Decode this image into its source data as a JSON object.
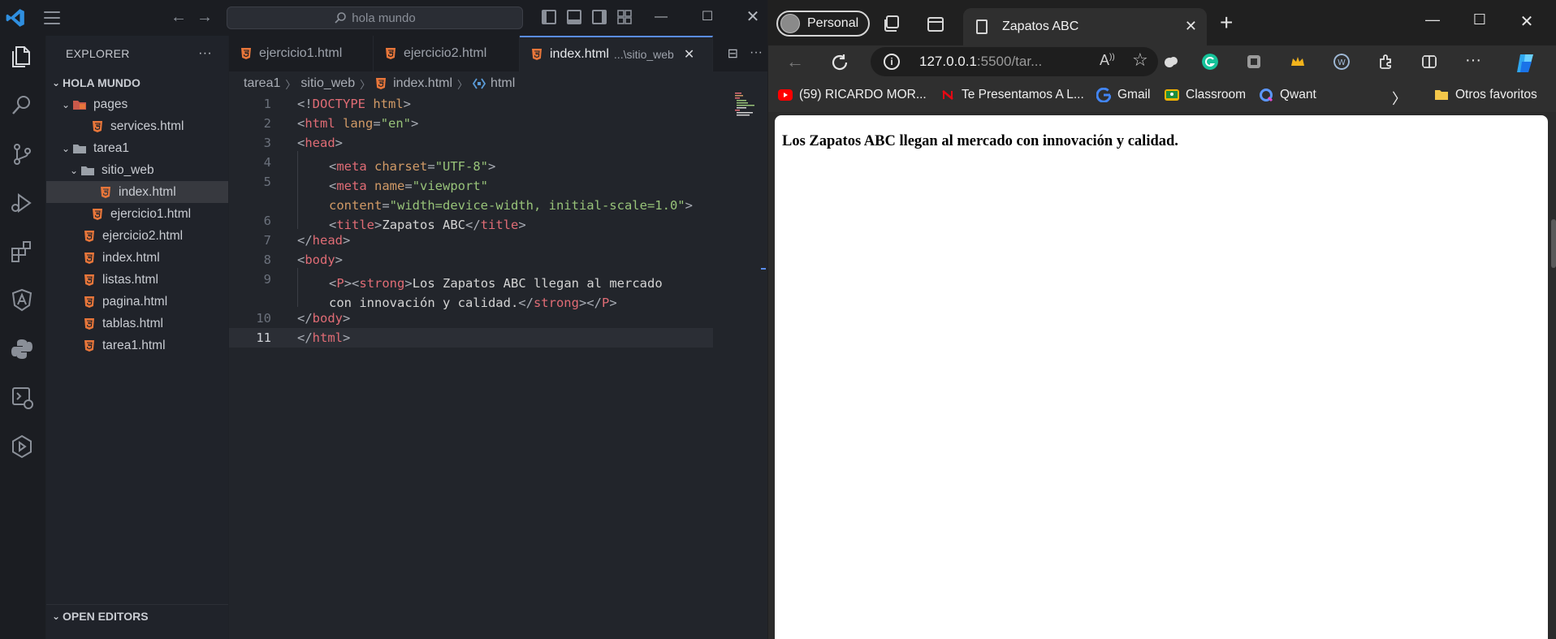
{
  "vscode": {
    "search_text": "hola mundo",
    "explorer": {
      "title": "EXPLORER",
      "more": "···",
      "root": "HOLA MUNDO",
      "items": [
        {
          "label": "pages",
          "kind": "folder"
        },
        {
          "label": "services.html",
          "kind": "file"
        },
        {
          "label": "tarea1",
          "kind": "folder"
        },
        {
          "label": "sitio_web",
          "kind": "folder"
        },
        {
          "label": "index.html",
          "kind": "file",
          "selected": true
        },
        {
          "label": "ejercicio1.html",
          "kind": "file"
        },
        {
          "label": "ejercicio2.html",
          "kind": "file"
        },
        {
          "label": "index.html",
          "kind": "file"
        },
        {
          "label": "listas.html",
          "kind": "file"
        },
        {
          "label": "pagina.html",
          "kind": "file"
        },
        {
          "label": "tablas.html",
          "kind": "file"
        },
        {
          "label": "tarea1.html",
          "kind": "file"
        }
      ],
      "open_editors": "OPEN EDITORS"
    },
    "tabs": [
      {
        "label": "ejercicio1.html"
      },
      {
        "label": "ejercicio2.html"
      },
      {
        "label": "index.html",
        "desc": "...\\sitio_web",
        "active": true
      }
    ],
    "tab_actions": {
      "split": "⊟",
      "more": "···"
    },
    "breadcrumb": [
      "tarea1",
      "sitio_web",
      "index.html",
      "html"
    ],
    "line_numbers": [
      "1",
      "2",
      "3",
      "4",
      "5",
      "",
      "6",
      "7",
      "8",
      "9",
      "",
      "10",
      "11"
    ],
    "current_line": "11"
  },
  "browser": {
    "profile": "Personal",
    "tab_title": "Zapatos ABC",
    "url_host": "127.0.0.1",
    "url_rest": ":5500/tar...",
    "bookmarks": [
      {
        "label": "(59) RICARDO MOR..."
      },
      {
        "label": "Te Presentamos A L..."
      },
      {
        "label": "Gmail"
      },
      {
        "label": "Classroom"
      },
      {
        "label": "Qwant"
      }
    ],
    "other_favorites": "Otros favoritos",
    "page_text": "Los Zapatos ABC llegan al mercado con innovación y calidad."
  },
  "colors": {
    "accent_blue": "#5a8dee",
    "html_orange": "#e8763a",
    "tag_red": "#e06c75",
    "string_green": "#98c379",
    "attr_orange": "#d19a66"
  },
  "icons": {
    "activity": [
      "files-icon",
      "search-icon",
      "source-control-icon",
      "run-debug-icon",
      "extensions-icon",
      "angular-icon",
      "python-icon",
      "remote-explorer-icon",
      "testing-icon"
    ]
  }
}
